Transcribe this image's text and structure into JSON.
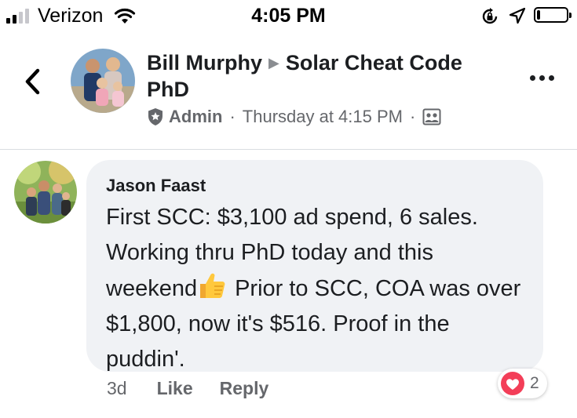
{
  "status_bar": {
    "carrier": "Verizon",
    "time": "4:05 PM",
    "signal_bars": 4,
    "signal_bars_active": 2,
    "battery_level": 0.12
  },
  "post_header": {
    "author": "Bill Murphy",
    "group": "Solar Cheat Code PhD",
    "role": "Admin",
    "timestamp": "Thursday at 4:15 PM",
    "audience_icon": "group-photo-icon",
    "separator": "·"
  },
  "comment": {
    "author": "Jason Faast",
    "text_before_emoji": "First SCC:  $3,100 ad spend, 6 sales. Working thru PhD today and this weekend",
    "emoji": "thumbs-up",
    "text_after_emoji": "Prior to SCC, COA was over $1,800, now it's $516.  Proof in the puddin'.",
    "age": "3d",
    "like_label": "Like",
    "reply_label": "Reply",
    "reaction_type": "love",
    "reaction_count": "2"
  },
  "colors": {
    "bubble": "#f0f2f5",
    "secondary_text": "#65676b",
    "love_red": "#f33e58",
    "thumb_yellow": "#ffc83d"
  }
}
